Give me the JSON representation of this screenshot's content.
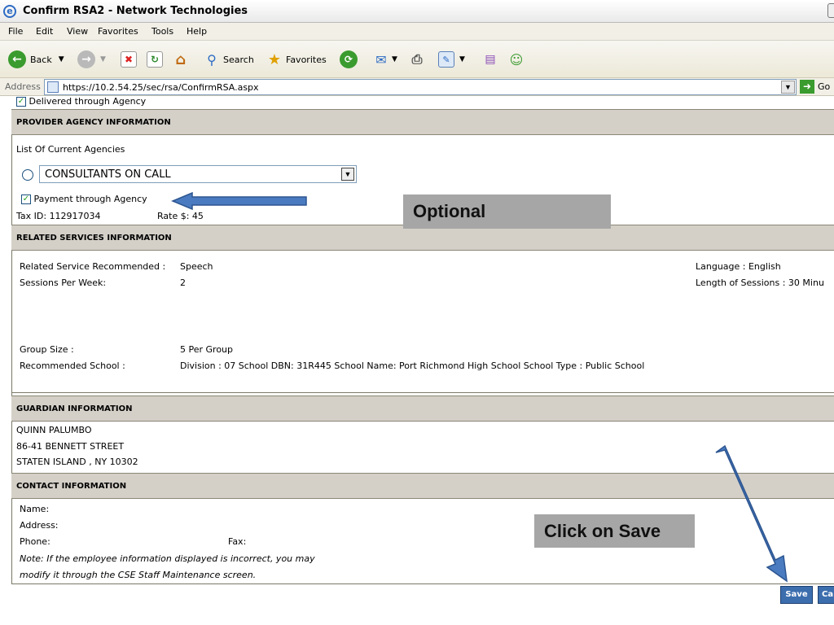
{
  "window": {
    "title": "Confirm RSA2 - Network Technologies"
  },
  "menu": [
    "File",
    "Edit",
    "View",
    "Favorites",
    "Tools",
    "Help"
  ],
  "toolbar": {
    "back_label": "Back",
    "search_label": "Search",
    "favorites_label": "Favorites"
  },
  "address": {
    "label": "Address",
    "url": "https://10.2.54.25/sec/rsa/ConfirmRSA.aspx",
    "go_label": "Go"
  },
  "delivered_label": "Delivered through Agency",
  "provider": {
    "header": "PROVIDER AGENCY INFORMATION",
    "list_label": "List Of Current Agencies",
    "selected_agency": "CONSULTANTS ON CALL",
    "payment_label": "Payment through Agency",
    "tax_id": "Tax ID: 112917034",
    "rate": "Rate $: 45"
  },
  "related": {
    "header": "RELATED SERVICES INFORMATION",
    "recommended_label": "Related Service Recommended :",
    "recommended_value": "Speech",
    "sessions_label": "Sessions Per Week:",
    "sessions_value": "2",
    "language": "Language : English",
    "length": "Length of Sessions : 30  Minu",
    "group_label": "Group Size :",
    "group_value": "5  Per Group",
    "school_label": "Recommended School :",
    "school_value": "Division : 07  School DBN: 31R445  School Name: Port Richmond High School  School Type : Public School"
  },
  "guardian": {
    "header": "GUARDIAN INFORMATION",
    "name": "QUINN PALUMBO",
    "street": "86-41 BENNETT STREET",
    "city": "STATEN ISLAND , NY 10302"
  },
  "contact": {
    "header": "CONTACT INFORMATION",
    "name_label": "Name:",
    "address_label": "Address:",
    "phone_label": "Phone:",
    "fax_label": "Fax:",
    "note1": "Note: If the employee information displayed is incorrect, you may",
    "note2": "modify it through the CSE Staff Maintenance screen."
  },
  "buttons": {
    "save": "Save",
    "cancel": "Ca"
  },
  "callouts": {
    "optional": "Optional",
    "click_save": "Click on Save"
  },
  "colors": {
    "section_header": "#d4d0c8",
    "callout_bg": "#a6a6a6",
    "arrow": "#4a7bc0",
    "button": "#3c6eae"
  }
}
